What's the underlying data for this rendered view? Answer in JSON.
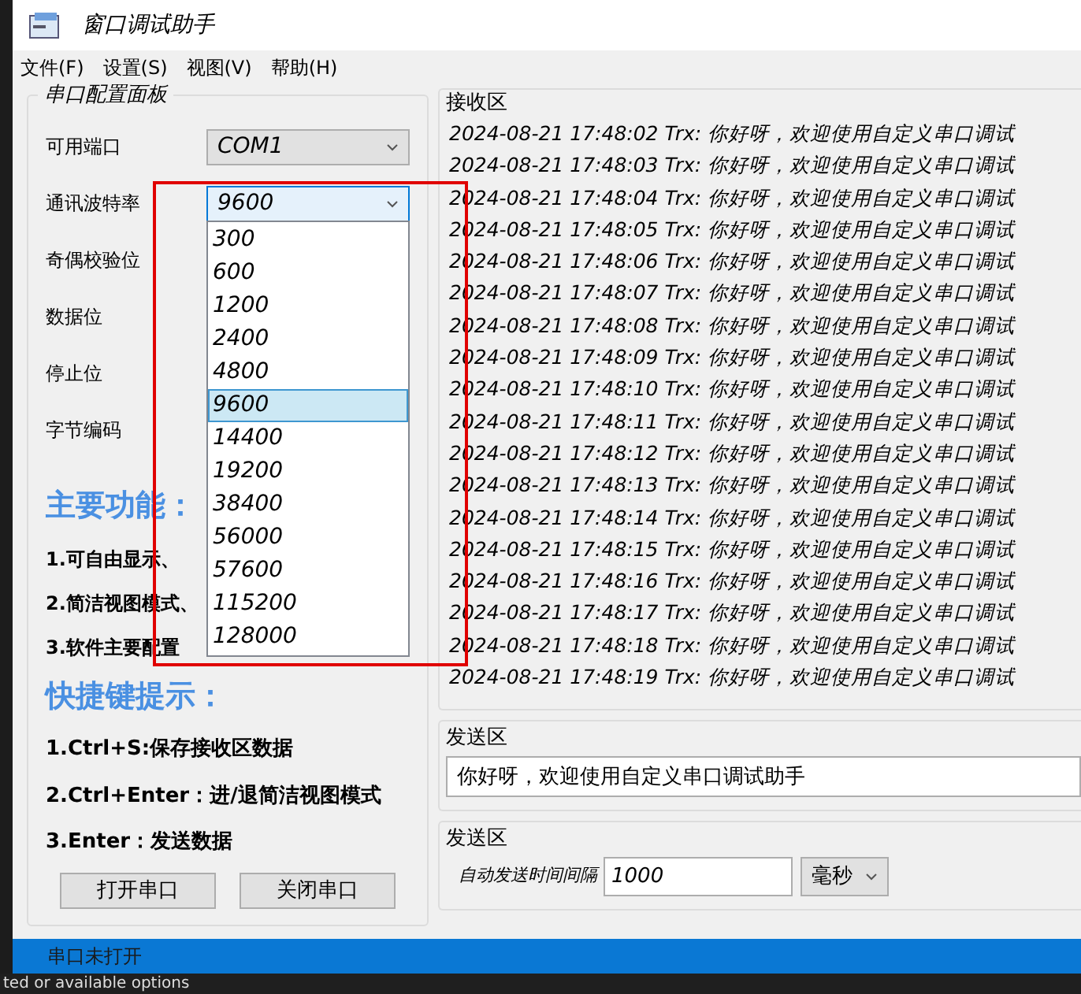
{
  "window": {
    "title": "窗口调试助手"
  },
  "menu": [
    "文件(F)",
    "设置(S)",
    "视图(V)",
    "帮助(H)"
  ],
  "config_panel": {
    "title": "串口配置面板",
    "fields": [
      {
        "label": "可用端口",
        "value": "COM1",
        "open": false
      },
      {
        "label": "通讯波特率",
        "value": "9600",
        "open": true
      },
      {
        "label": "奇偶校验位"
      },
      {
        "label": "数据位"
      },
      {
        "label": "停止位"
      },
      {
        "label": "字节编码"
      }
    ],
    "baud_options": [
      {
        "label": "300",
        "selected": false
      },
      {
        "label": "600",
        "selected": false
      },
      {
        "label": "1200",
        "selected": false
      },
      {
        "label": "2400",
        "selected": false
      },
      {
        "label": "4800",
        "selected": false
      },
      {
        "label": "9600",
        "selected": true
      },
      {
        "label": "14400",
        "selected": false
      },
      {
        "label": "19200",
        "selected": false
      },
      {
        "label": "38400",
        "selected": false
      },
      {
        "label": "56000",
        "selected": false
      },
      {
        "label": "57600",
        "selected": false
      },
      {
        "label": "115200",
        "selected": false
      },
      {
        "label": "128000",
        "selected": false
      }
    ],
    "features_heading": "主要功能：",
    "features": [
      "1.可自由显示、",
      "2.简洁视图模式、",
      "3.软件主要配置"
    ],
    "shortcuts_heading": "快捷键提示：",
    "shortcuts": [
      "1.Ctrl+S:保存接收区数据",
      "2.Ctrl+Enter：进/退简洁视图模式",
      "3.Enter：发送数据"
    ],
    "buttons": [
      "打开串口",
      "关闭串口"
    ]
  },
  "receive": {
    "title": "接收区",
    "lines": [
      "2024-08-21 17:48:02 Trx: 你好呀，欢迎使用自定义串口调试",
      "2024-08-21 17:48:03 Trx: 你好呀，欢迎使用自定义串口调试",
      "2024-08-21 17:48:04 Trx: 你好呀，欢迎使用自定义串口调试",
      "2024-08-21 17:48:05 Trx: 你好呀，欢迎使用自定义串口调试",
      "2024-08-21 17:48:06 Trx: 你好呀，欢迎使用自定义串口调试",
      "2024-08-21 17:48:07 Trx: 你好呀，欢迎使用自定义串口调试",
      "2024-08-21 17:48:08 Trx: 你好呀，欢迎使用自定义串口调试",
      "2024-08-21 17:48:09 Trx: 你好呀，欢迎使用自定义串口调试",
      "2024-08-21 17:48:10 Trx: 你好呀，欢迎使用自定义串口调试",
      "2024-08-21 17:48:11 Trx: 你好呀，欢迎使用自定义串口调试",
      "2024-08-21 17:48:12 Trx: 你好呀，欢迎使用自定义串口调试",
      "2024-08-21 17:48:13 Trx: 你好呀，欢迎使用自定义串口调试",
      "2024-08-21 17:48:14 Trx: 你好呀，欢迎使用自定义串口调试",
      "2024-08-21 17:48:15 Trx: 你好呀，欢迎使用自定义串口调试",
      "2024-08-21 17:48:16 Trx: 你好呀，欢迎使用自定义串口调试",
      "2024-08-21 17:48:17 Trx: 你好呀，欢迎使用自定义串口调试",
      "2024-08-21 17:48:18 Trx: 你好呀，欢迎使用自定义串口调试",
      "2024-08-21 17:48:19 Trx: 你好呀，欢迎使用自定义串口调试"
    ]
  },
  "send": {
    "title": "发送区",
    "value": "你好呀，欢迎使用自定义串口调试助手"
  },
  "auto_send": {
    "title": "发送区",
    "label": "自动发送时间间隔",
    "value": "1000",
    "unit": "毫秒"
  },
  "status_bar": "串口未打开",
  "background_text": "ted or available options"
}
